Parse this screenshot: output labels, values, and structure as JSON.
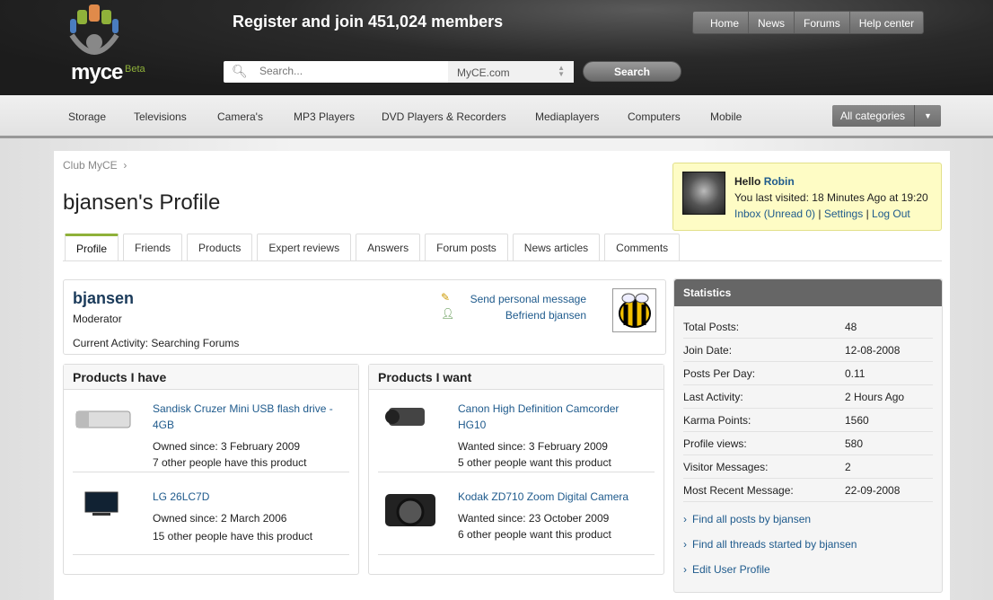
{
  "header": {
    "logo": "myce",
    "beta": "Beta",
    "register": "Register and join 451,024 members",
    "search_placeholder": "Search...",
    "scope": "MyCE.com",
    "search_button": "Search",
    "topnav": [
      "Home",
      "News",
      "Forums",
      "Help center"
    ]
  },
  "categories": [
    "Storage",
    "Televisions",
    "Camera's",
    "MP3 Players",
    "DVD Players & Recorders",
    "Mediaplayers",
    "Computers",
    "Mobile"
  ],
  "all_categories": "All categories",
  "breadcrumb": "Club MyCE",
  "title": "bjansen's Profile",
  "tabs": [
    "Profile",
    "Friends",
    "Products",
    "Expert reviews",
    "Answers",
    "Forum posts",
    "News articles",
    "Comments"
  ],
  "hello": {
    "hello": "Hello",
    "name": "Robin",
    "visited": "You last visited: 18 Minutes Ago at",
    "time": "19:20",
    "inbox": "Inbox (Unread 0)",
    "settings": "Settings",
    "logout": "Log Out",
    "sep": "|"
  },
  "card": {
    "name": "bjansen",
    "role": "Moderator",
    "activity": "Current Activity: Searching Forums",
    "send": "Send personal message",
    "befriend": "Befriend bjansen"
  },
  "have": {
    "title": "Products I have",
    "items": [
      {
        "name": "Sandisk Cruzer Mini USB flash drive - 4GB",
        "since": "Owned since: 3 February 2009",
        "others": "7 other people have this product"
      },
      {
        "name": "LG 26LC7D",
        "since": "Owned since: 2 March 2006",
        "others": "15 other people have this product"
      }
    ]
  },
  "want": {
    "title": "Products I want",
    "items": [
      {
        "name": "Canon High Definition Camcorder HG10",
        "since": "Wanted since: 3 February 2009",
        "others": "5 other people want this product"
      },
      {
        "name": "Kodak ZD710 Zoom Digital Camera",
        "since": "Wanted since: 23 October 2009",
        "others": "6 other people want this product"
      }
    ]
  },
  "stats": {
    "title": "Statistics",
    "rows": [
      {
        "k": "Total Posts:",
        "v": "48"
      },
      {
        "k": "Join Date:",
        "v": "12-08-2008"
      },
      {
        "k": "Posts Per Day:",
        "v": "0.11"
      },
      {
        "k": "Last Activity:",
        "v": "2 Hours Ago"
      },
      {
        "k": "Karma Points:",
        "v": "1560"
      },
      {
        "k": "Profile views:",
        "v": "580"
      },
      {
        "k": "Visitor Messages:",
        "v": "2"
      },
      {
        "k": "Most Recent Message:",
        "v": "22-09-2008"
      }
    ],
    "links": [
      "Find all posts by bjansen",
      "Find all threads started by bjansen",
      "Edit User Profile"
    ]
  }
}
